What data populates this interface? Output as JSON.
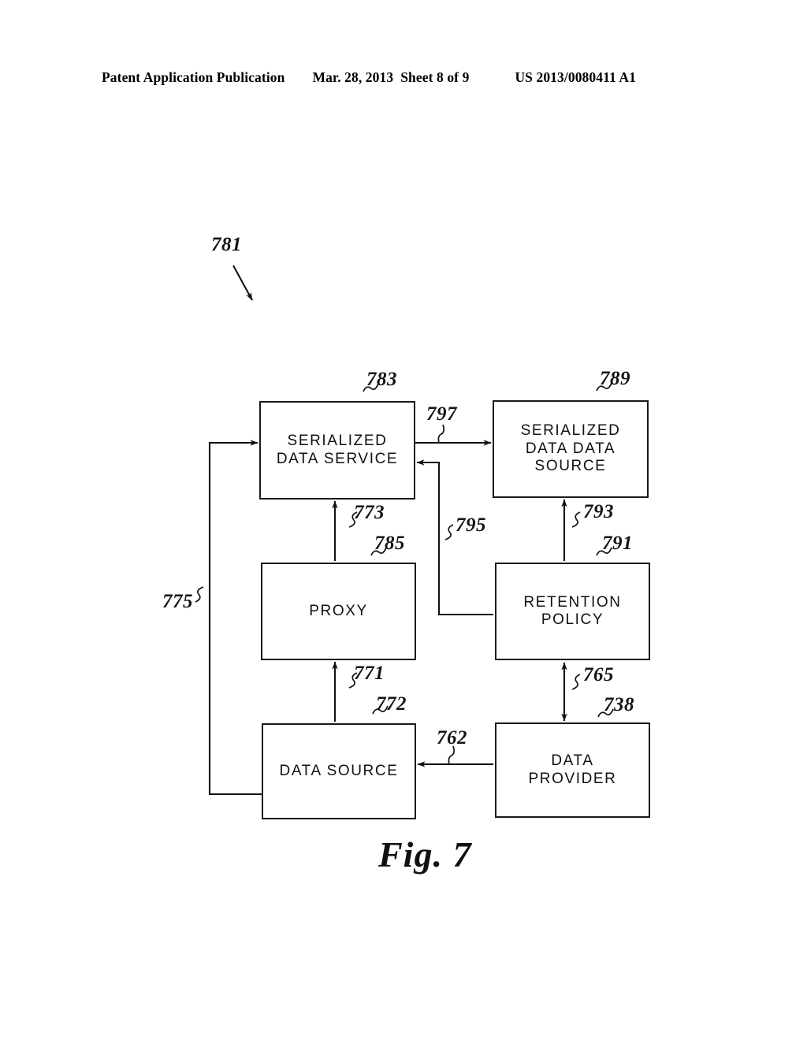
{
  "header": {
    "publication": "Patent Application Publication",
    "date": "Mar. 28, 2013",
    "sheet": "Sheet 8 of 9",
    "document_number": "US 2013/0080411 A1"
  },
  "figure": {
    "caption": "Fig. 7",
    "system_reference": "781"
  },
  "diagram": {
    "nodes": [
      {
        "id": "serialized-data-service",
        "label": "SERIALIZED\nDATA SERVICE",
        "ref": "783"
      },
      {
        "id": "serialized-data-data-source",
        "label": "SERIALIZED\nDATA DATA\nSOURCE",
        "ref": "789"
      },
      {
        "id": "proxy",
        "label": "PROXY",
        "ref": "785"
      },
      {
        "id": "retention-policy",
        "label": "RETENTION\nPOLICY",
        "ref": "791"
      },
      {
        "id": "data-source",
        "label": "DATA SOURCE",
        "ref": "772"
      },
      {
        "id": "data-provider",
        "label": "DATA\nPROVIDER",
        "ref": "738"
      }
    ],
    "connectors": [
      {
        "ref": "775",
        "from": "data-source",
        "to": "serialized-data-service",
        "arrows": "single"
      },
      {
        "ref": "797",
        "from": "serialized-data-service",
        "to": "serialized-data-data-source",
        "arrows": "single"
      },
      {
        "ref": "795",
        "from": "retention-policy",
        "to": "serialized-data-service",
        "arrows": "single"
      },
      {
        "ref": "773",
        "from": "proxy",
        "to": "serialized-data-service",
        "arrows": "single"
      },
      {
        "ref": "793",
        "from": "retention-policy",
        "to": "serialized-data-data-source",
        "arrows": "single"
      },
      {
        "ref": "771",
        "from": "data-source",
        "to": "proxy",
        "arrows": "single"
      },
      {
        "ref": "765",
        "from": "data-provider",
        "to": "retention-policy",
        "arrows": "double"
      },
      {
        "ref": "762",
        "from": "data-provider",
        "to": "data-source",
        "arrows": "single"
      }
    ]
  },
  "colors": {
    "ink": "#111111",
    "paper": "#ffffff"
  }
}
